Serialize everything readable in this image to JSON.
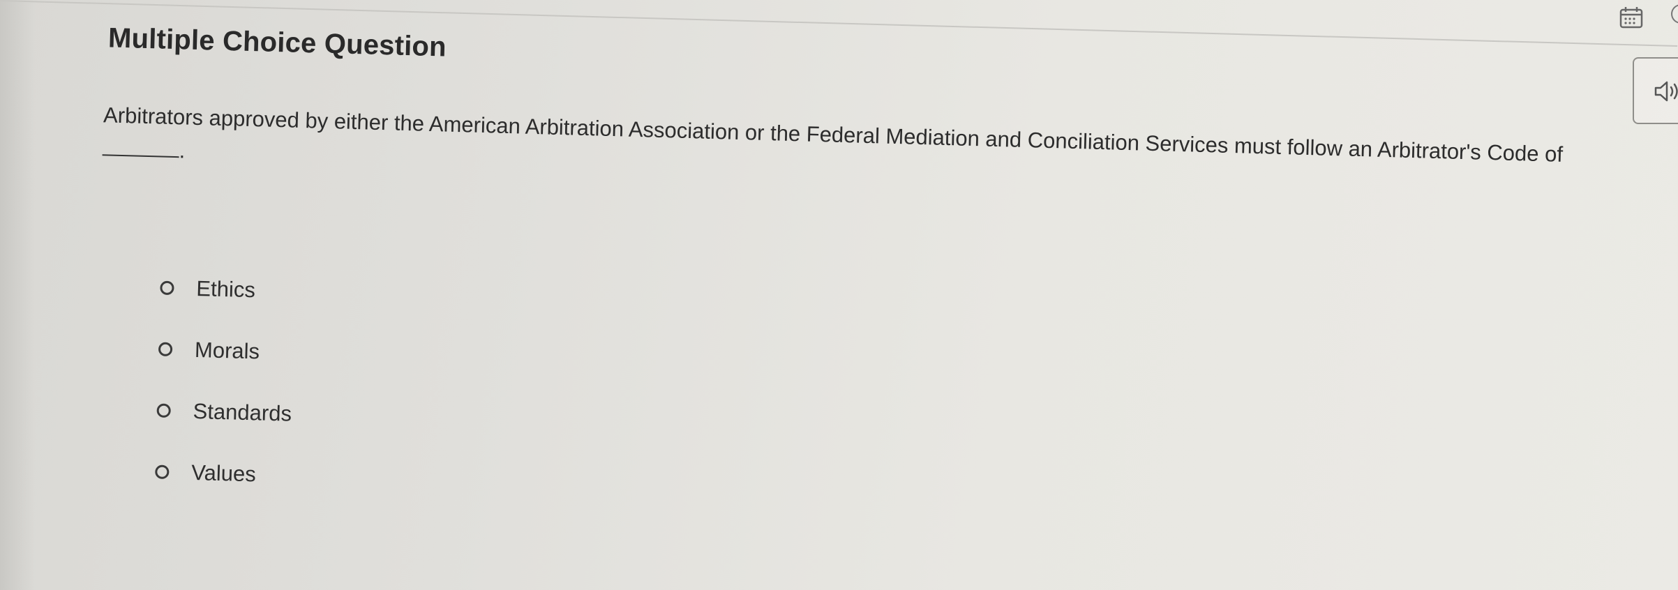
{
  "question": {
    "type_label": "Multiple Choice Question",
    "prompt_text": "Arbitrators approved by either the American Arbitration Association or the Federal Mediation and Conciliation Services must follow an Arbitrator's Code of",
    "prompt_end": "."
  },
  "options": [
    {
      "label": "Ethics",
      "selected": false
    },
    {
      "label": "Morals",
      "selected": false
    },
    {
      "label": "Standards",
      "selected": false
    },
    {
      "label": "Values",
      "selected": false
    }
  ],
  "toolbar": {
    "audio_icon": "speaker-icon",
    "calendar_icon": "calendar-icon"
  },
  "colors": {
    "text": "#2b2b2b",
    "background": "#e6e5e0"
  }
}
